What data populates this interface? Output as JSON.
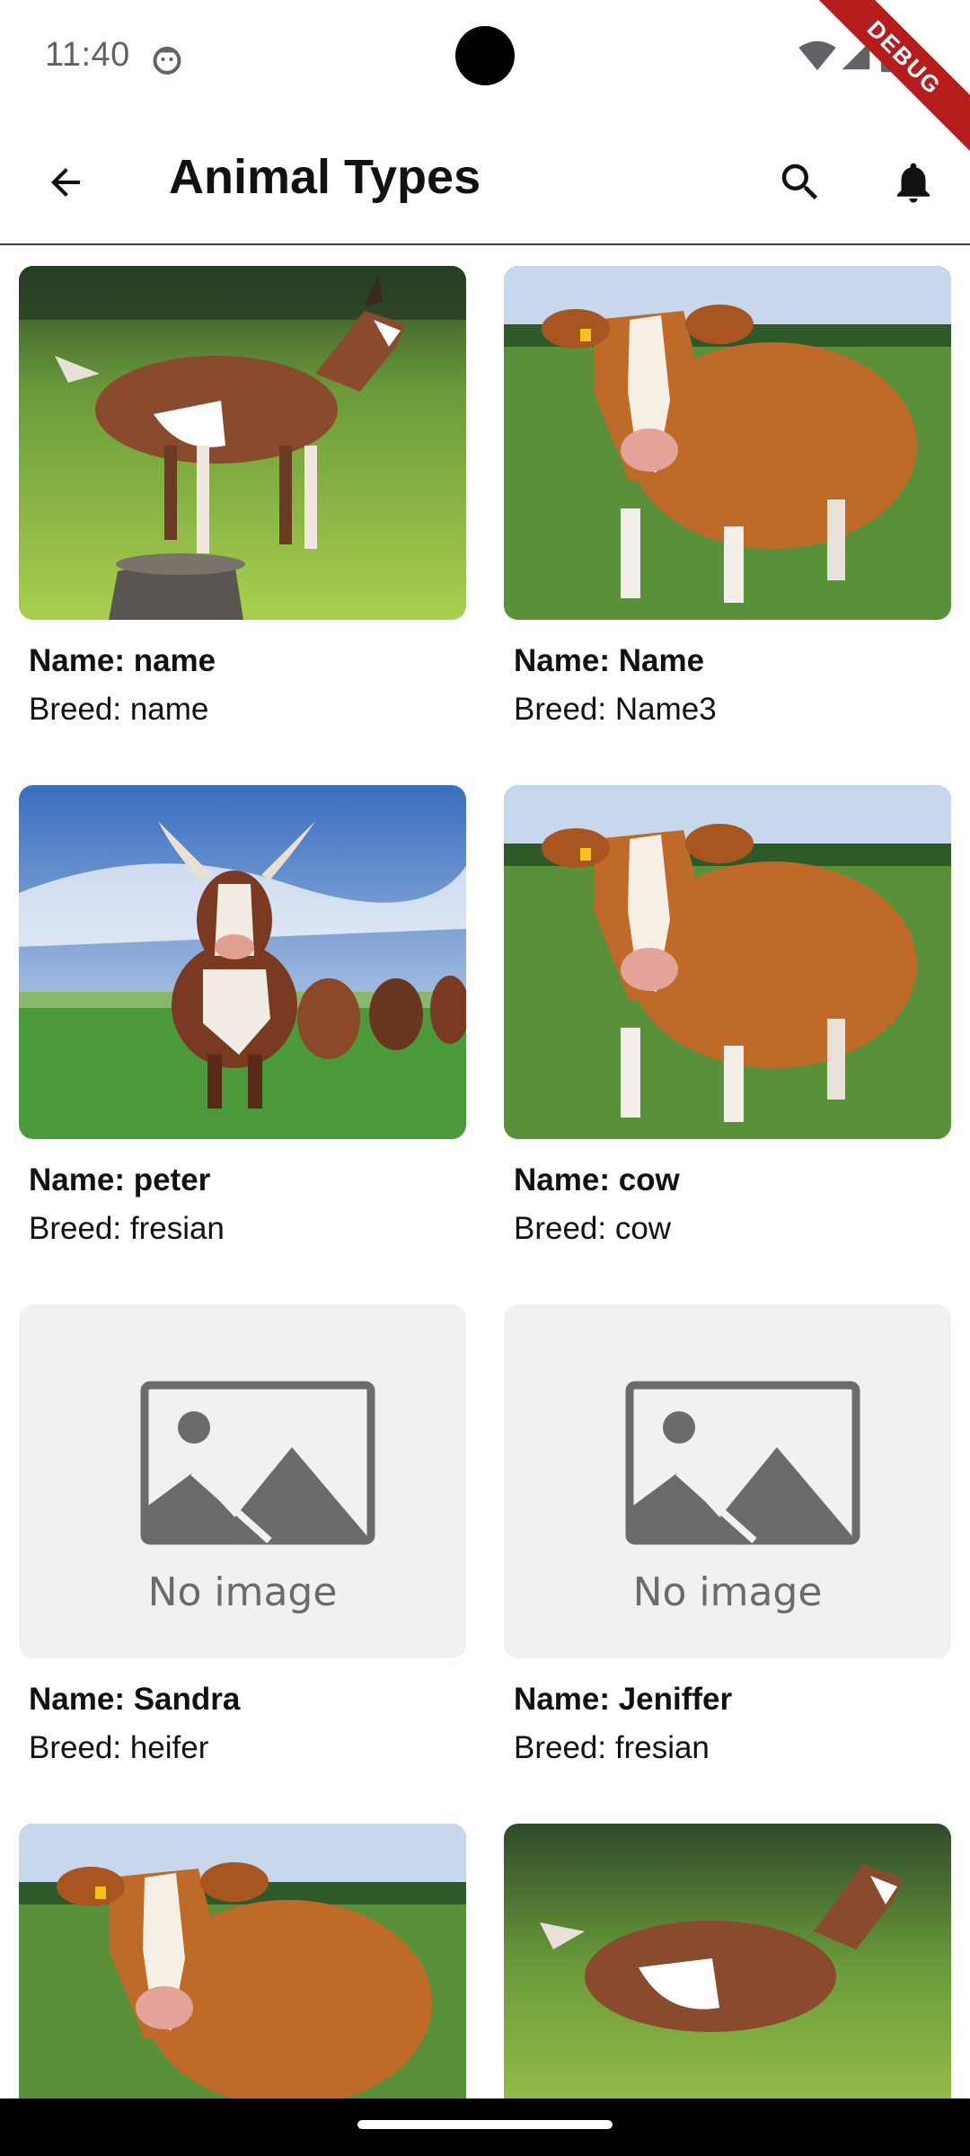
{
  "status_bar": {
    "time": "11:40",
    "icons": [
      "notification-face-icon",
      "wifi-icon",
      "signal-icon",
      "battery-icon"
    ]
  },
  "debug_banner": "DEBUG",
  "app_bar": {
    "title": "Animal Types",
    "back_icon": "arrow-back-icon",
    "search_icon": "search-icon",
    "notifications_icon": "bell-icon"
  },
  "animals": [
    {
      "name_label": "Name: name",
      "breed_label": "Breed: name",
      "image": "goat"
    },
    {
      "name_label": "Name: Name",
      "breed_label": "Breed: Name3",
      "image": "cow"
    },
    {
      "name_label": "Name: peter",
      "breed_label": "Breed: fresian",
      "image": "cows-herd"
    },
    {
      "name_label": "Name: cow",
      "breed_label": "Breed: cow",
      "image": "cow"
    },
    {
      "name_label": "Name: Sandra",
      "breed_label": "Breed: heifer",
      "image": "placeholder"
    },
    {
      "name_label": "Name: Jeniffer",
      "breed_label": "Breed: fresian",
      "image": "placeholder"
    },
    {
      "image": "cow"
    },
    {
      "image": "goat"
    }
  ],
  "placeholder_text": "No image",
  "colors": {
    "debug_banner": "#b71c1c",
    "placeholder_bg": "#f0f1f1",
    "placeholder_fg": "#6b6b6b",
    "status_text": "#5f6368"
  }
}
